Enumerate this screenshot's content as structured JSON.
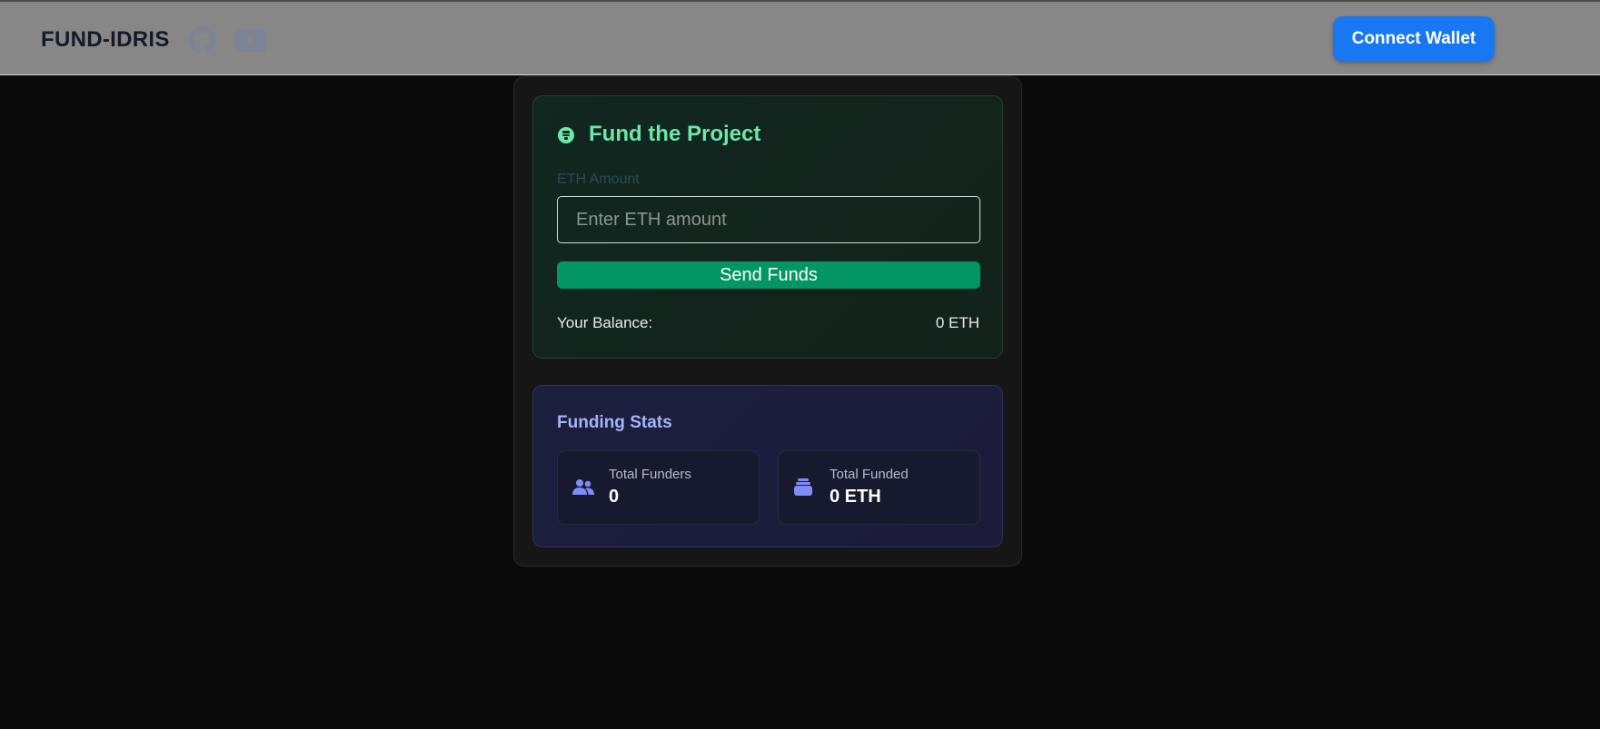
{
  "navbar": {
    "brand": "FUND-IDRIS",
    "icons": [
      "github-icon",
      "youtube-icon"
    ],
    "connect_label": "Connect Wallet",
    "connect_color": "#1877f2"
  },
  "fund": {
    "title": "Fund the Project",
    "title_icon": "coin-icon",
    "input_label": "ETH Amount",
    "input_placeholder": "Enter ETH amount",
    "input_value": "",
    "send_label": "Send Funds",
    "balance_label": "Your Balance:",
    "balance_value": "0 ETH",
    "accent": "#6ee7a8",
    "button_color": "#039563"
  },
  "stats": {
    "title": "Funding Stats",
    "accent": "#a5b4fc",
    "items": [
      {
        "label": "Total Funders",
        "value": "0",
        "icon": "users-icon"
      },
      {
        "label": "Total Funded",
        "value": "0 ETH",
        "icon": "coins-stack-icon"
      }
    ]
  }
}
